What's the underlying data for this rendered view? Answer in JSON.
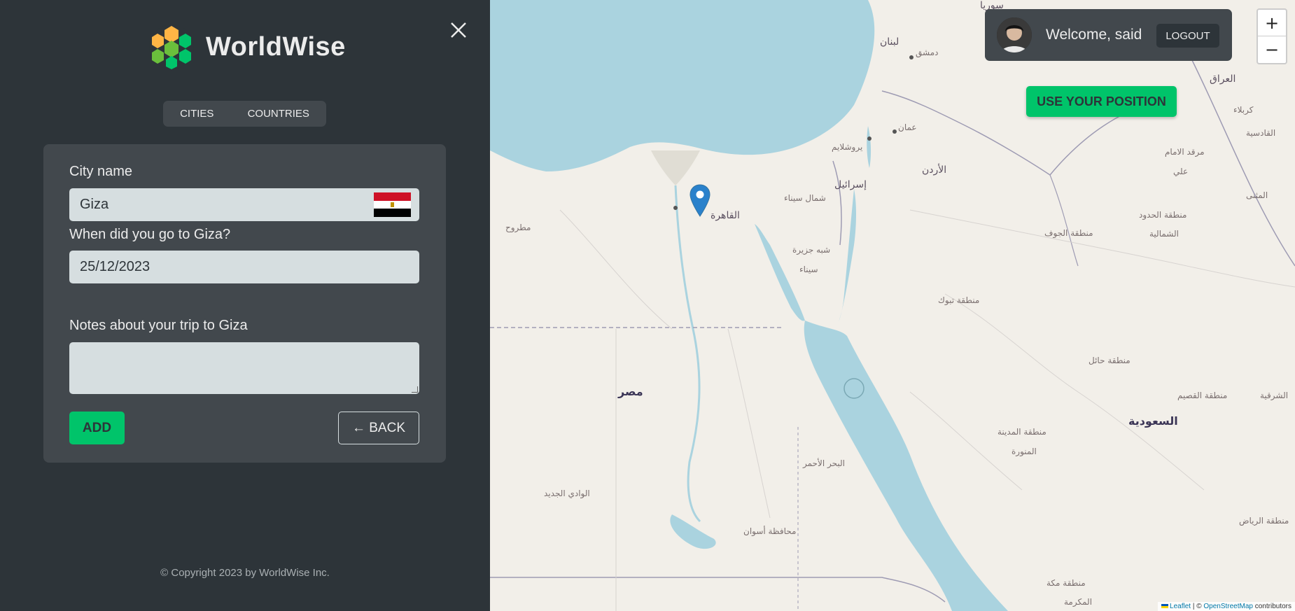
{
  "app": {
    "name": "WorldWise",
    "copyright": "© Copyright 2023 by WorldWise Inc."
  },
  "tabs": [
    "CITIES",
    "COUNTRIES"
  ],
  "form": {
    "city_label": "City name",
    "city_value": "Giza",
    "date_label": "When did you go to Giza?",
    "date_value": "25/12/2023",
    "notes_label": "Notes about your trip to Giza",
    "notes_value": "",
    "add_button": "ADD",
    "back_button": "← BACK"
  },
  "user": {
    "welcome": "Welcome, said",
    "logout": "LOGOUT"
  },
  "map": {
    "use_position": "USE YOUR POSITION",
    "zoom_in": "+",
    "zoom_out": "−",
    "attribution_leaflet": "Leaflet",
    "attribution_sep": "| ©",
    "attribution_osm": "OpenStreetMap",
    "attribution_tail": "contributors",
    "labels": [
      {
        "text": "مصر",
        "cls": "big"
      },
      {
        "text": "السعودية",
        "cls": "big"
      },
      {
        "text": "الأردن",
        "cls": "mid"
      },
      {
        "text": "إسرائيل",
        "cls": "mid"
      },
      {
        "text": "لبنان",
        "cls": "mid"
      },
      {
        "text": "العراق",
        "cls": "mid"
      },
      {
        "text": "سوريا",
        "cls": "mid"
      },
      {
        "text": "القاهرة",
        "cls": "mid"
      },
      {
        "text": "دمشق",
        "cls": ""
      },
      {
        "text": "عمان",
        "cls": ""
      },
      {
        "text": "يروشلايم",
        "cls": ""
      },
      {
        "text": "شمال سيناء",
        "cls": ""
      },
      {
        "text": "شبه جزيرة",
        "cls": ""
      },
      {
        "text": "سيناء",
        "cls": ""
      },
      {
        "text": "مطروح",
        "cls": ""
      },
      {
        "text": "الوادي الجديد",
        "cls": ""
      },
      {
        "text": "البحر الأحمر",
        "cls": ""
      },
      {
        "text": "محافظة أسوان",
        "cls": ""
      },
      {
        "text": "منطقة تبوك",
        "cls": ""
      },
      {
        "text": "منطقة الجوف",
        "cls": ""
      },
      {
        "text": "منطقة حائل",
        "cls": ""
      },
      {
        "text": "منطقة المدينة",
        "cls": ""
      },
      {
        "text": "المنورة",
        "cls": ""
      },
      {
        "text": "منطقة القصيم",
        "cls": ""
      },
      {
        "text": "منطقة الرياض",
        "cls": ""
      },
      {
        "text": "منطقة مكة",
        "cls": ""
      },
      {
        "text": "المكرمة",
        "cls": ""
      },
      {
        "text": "منطقة الحدود",
        "cls": ""
      },
      {
        "text": "الشمالية",
        "cls": ""
      },
      {
        "text": "مرقد الامام",
        "cls": ""
      },
      {
        "text": "علي",
        "cls": ""
      },
      {
        "text": "المثنى",
        "cls": ""
      },
      {
        "text": "كربلاء",
        "cls": ""
      },
      {
        "text": "القادسية",
        "cls": ""
      },
      {
        "text": "الشرقية",
        "cls": ""
      }
    ]
  },
  "colors": {
    "brand_green": "#00c46a",
    "dark_bg": "#2d3439",
    "panel_bg": "#42484d",
    "input_bg": "#d6dee0",
    "water": "#aad3df"
  }
}
